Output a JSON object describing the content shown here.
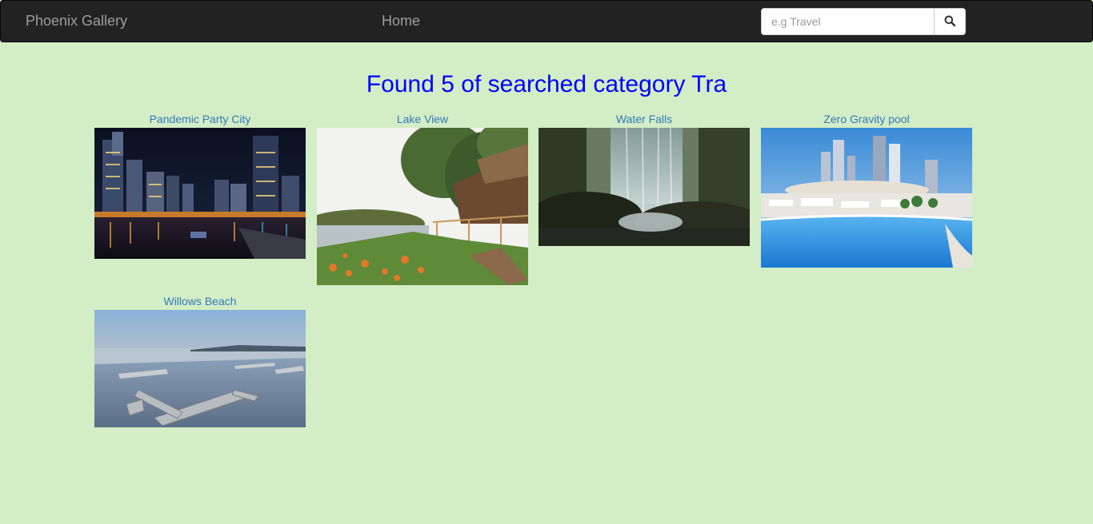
{
  "navbar": {
    "brand": "Phoenix Gallery",
    "home_label": "Home",
    "search": {
      "placeholder": "e.g Travel",
      "value": ""
    },
    "search_icon": "search-icon"
  },
  "main": {
    "heading": "Found 5 of searched category Tra",
    "cards": [
      {
        "title": "Pandemic Party City"
      },
      {
        "title": "Lake View"
      },
      {
        "title": "Water Falls"
      },
      {
        "title": "Zero Gravity pool"
      },
      {
        "title": "Willows Beach"
      }
    ]
  },
  "colors": {
    "background": "#d3edc6",
    "navbar": "#222222",
    "heading": "#0000ff",
    "link": "#337ab7"
  }
}
